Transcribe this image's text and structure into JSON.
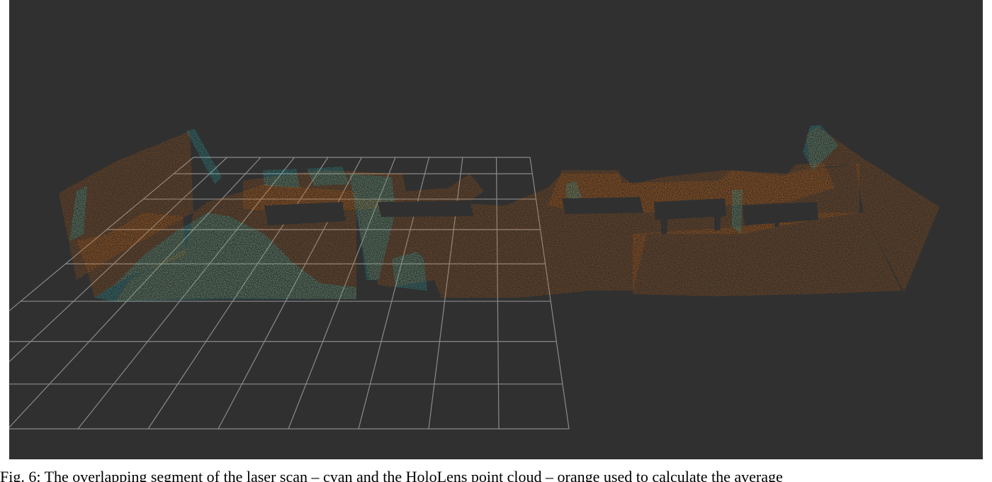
{
  "figure": {
    "caption": "Fig. 6: The overlapping segment of the laser scan – cyan and the HoloLens point cloud – orange used to calculate the average"
  },
  "viewer": {
    "background_color": "#303030",
    "grid_color": "#8a8a8a"
  },
  "legend": {
    "laser_scan": {
      "label": "laser scan",
      "color": "#1fd3d6",
      "icon": "cyan-point-cloud"
    },
    "hololens": {
      "label": "HoloLens point cloud",
      "color": "#d9620f",
      "icon": "orange-point-cloud"
    }
  }
}
